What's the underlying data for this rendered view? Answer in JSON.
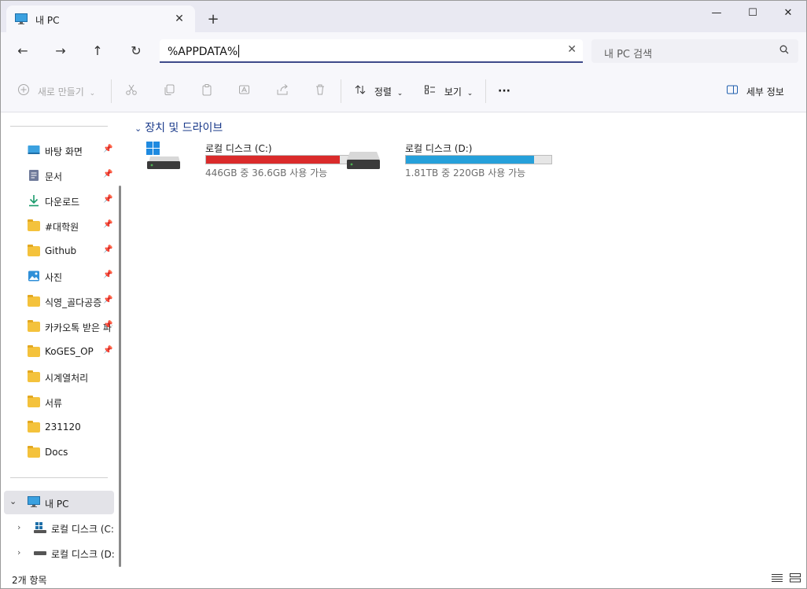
{
  "tab": {
    "title": "내 PC",
    "close": "✕",
    "new_tab": "+"
  },
  "window_controls": {
    "minimize": "—",
    "maximize": "☐",
    "close": "✕"
  },
  "nav": {
    "back": "←",
    "forward": "→",
    "up": "↑",
    "refresh": "↻"
  },
  "address": {
    "value": "%APPDATA%",
    "clear": "✕"
  },
  "search": {
    "placeholder": "내 PC 검색",
    "icon": "search-icon"
  },
  "toolbar": {
    "new_label": "새로 만들기",
    "sort_label": "정렬",
    "view_label": "보기",
    "more": "···",
    "details_label": "세부 정보"
  },
  "sidebar": {
    "items": [
      {
        "label": "바탕 화면",
        "icon": "desktop-icon",
        "pinned": true
      },
      {
        "label": "문서",
        "icon": "document-icon",
        "pinned": true
      },
      {
        "label": "다운로드",
        "icon": "download-icon",
        "pinned": true
      },
      {
        "label": "#대학원",
        "icon": "folder-icon",
        "pinned": true
      },
      {
        "label": "Github",
        "icon": "folder-icon",
        "pinned": true
      },
      {
        "label": "사진",
        "icon": "pictures-icon",
        "pinned": true
      },
      {
        "label": "식영_골다공증",
        "icon": "folder-icon",
        "pinned": true
      },
      {
        "label": "카카오톡 받은 파일",
        "icon": "folder-icon",
        "pinned": true
      },
      {
        "label": "KoGES_OP",
        "icon": "folder-icon",
        "pinned": true
      },
      {
        "label": "시계열처리",
        "icon": "folder-icon",
        "pinned": false
      },
      {
        "label": "서류",
        "icon": "folder-icon",
        "pinned": false
      },
      {
        "label": "231120",
        "icon": "folder-icon",
        "pinned": false
      },
      {
        "label": "Docs",
        "icon": "folder-icon",
        "pinned": false
      }
    ],
    "this_pc": "내 PC",
    "drives": [
      {
        "label": "로컬 디스크 (C:)"
      },
      {
        "label": "로컬 디스크 (D:)"
      }
    ]
  },
  "content": {
    "group_header": "장치 및 드라이브",
    "drives": [
      {
        "name": "로컬 디스크 (C:)",
        "info": "446GB 중 36.6GB 사용 가능",
        "used_fraction": 0.918,
        "bar_color": "#da2b2b"
      },
      {
        "name": "로컬 디스크 (D:)",
        "info": "1.81TB 중 220GB 사용 가능",
        "used_fraction": 0.88,
        "bar_color": "#26a0da"
      }
    ]
  },
  "status": {
    "count": "2개 항목"
  },
  "colors": {
    "accent": "#3e4a8a",
    "header_text": "#1a3a8a",
    "chrome": "#f7f7fb"
  }
}
